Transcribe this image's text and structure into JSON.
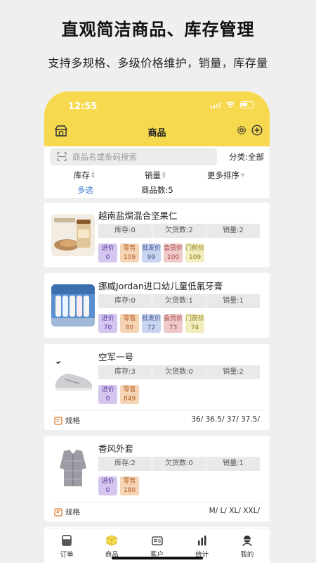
{
  "headline": "直观简洁商品、库存管理",
  "subline": "支持多规格、多级价格维护，销量，库存量",
  "status": {
    "time": "12:55"
  },
  "header": {
    "title": "商品",
    "icons": [
      "store-icon",
      "gear-icon",
      "plus-circle-icon"
    ]
  },
  "search": {
    "placeholder": "商品名或条码搜索",
    "category_label": "分类:全部"
  },
  "sort": {
    "stock": "库存",
    "sales": "销量",
    "more": "更多排序"
  },
  "info": {
    "multiselect": "多选",
    "count": "商品数:5"
  },
  "products": [
    {
      "name": "越南盐焗混合坚果仁",
      "stock": "库存:0",
      "owed": "欠货数:2",
      "sales": "销量:2",
      "prices": [
        {
          "label": "进价",
          "value": "0",
          "color": "purple"
        },
        {
          "label": "零售",
          "value": "109",
          "color": "orange"
        },
        {
          "label": "批发价",
          "value": "99",
          "color": "blue"
        },
        {
          "label": "会员价",
          "value": "100",
          "color": "pink"
        },
        {
          "label": "门前价",
          "value": "109",
          "color": "yellow"
        }
      ]
    },
    {
      "name": "挪威Jordan进口幼儿童低氟牙膏",
      "stock": "库存:0",
      "owed": "欠货数:1",
      "sales": "销量:1",
      "prices": [
        {
          "label": "进价",
          "value": "70",
          "color": "purple"
        },
        {
          "label": "零售",
          "value": "80",
          "color": "orange"
        },
        {
          "label": "批发价",
          "value": "72",
          "color": "blue"
        },
        {
          "label": "会员价",
          "value": "73",
          "color": "pink"
        },
        {
          "label": "门前价",
          "value": "74",
          "color": "yellow"
        }
      ]
    },
    {
      "name": "空军一号",
      "stock": "库存:3",
      "owed": "欠货数:0",
      "sales": "销量:2",
      "prices": [
        {
          "label": "进价",
          "value": "0",
          "color": "purple"
        },
        {
          "label": "零售",
          "value": "849",
          "color": "orange"
        }
      ],
      "spec_label": "规格",
      "spec_values": "36/ 36.5/ 37/ 37.5/"
    },
    {
      "name": "香风外套",
      "stock": "库存:2",
      "owed": "欠货数:0",
      "sales": "销量:1",
      "prices": [
        {
          "label": "进价",
          "value": "0",
          "color": "purple"
        },
        {
          "label": "零售",
          "value": "180",
          "color": "orange"
        }
      ],
      "spec_label": "规格",
      "spec_values": "M/ L/ XL/ XXL/"
    }
  ],
  "tabs": [
    {
      "label": "订单",
      "icon": "order-icon"
    },
    {
      "label": "商品",
      "icon": "box-icon"
    },
    {
      "label": "客户",
      "icon": "customer-icon"
    },
    {
      "label": "统计",
      "icon": "chart-icon"
    },
    {
      "label": "我的",
      "icon": "profile-icon"
    }
  ],
  "colors": {
    "accent": "#f6d94f",
    "link": "#3a7bd5",
    "background": "#efefef"
  }
}
